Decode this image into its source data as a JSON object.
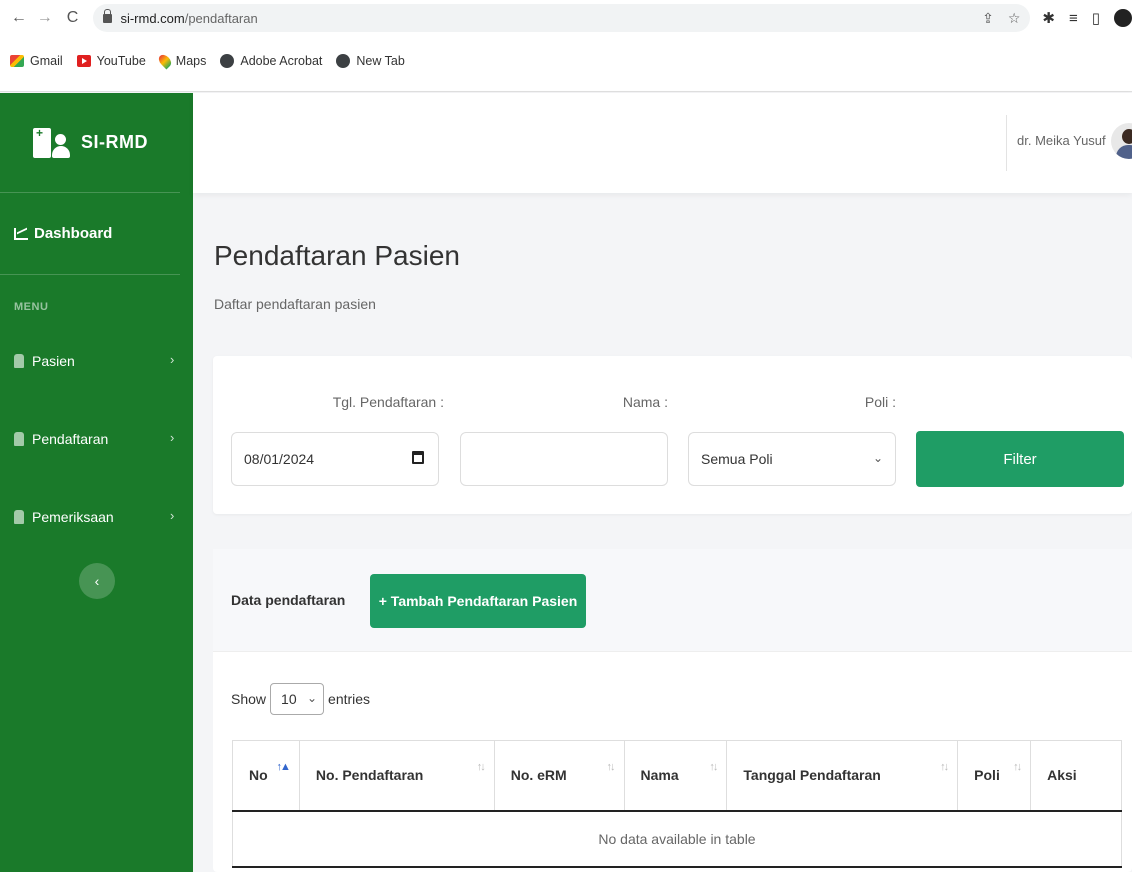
{
  "browser": {
    "url_domain": "si-rmd.com",
    "url_path": "/pendaftaran",
    "bookmarks": [
      "Gmail",
      "YouTube",
      "Maps",
      "Adobe Acrobat",
      "New Tab"
    ]
  },
  "sidebar": {
    "brand": "SI-RMD",
    "dashboard_label": "Dashboard",
    "menu_heading": "MENU",
    "items": [
      {
        "label": "Pasien"
      },
      {
        "label": "Pendaftaran"
      },
      {
        "label": "Pemeriksaan"
      }
    ],
    "collapse_glyph": "‹"
  },
  "topbar": {
    "user_name": "dr. Meika Yusuf"
  },
  "page": {
    "title": "Pendaftaran Pasien",
    "subtitle": "Daftar pendaftaran pasien"
  },
  "filter": {
    "date_label": "Tgl. Pendaftaran :",
    "date_value": "08/01/2024",
    "name_label": "Nama :",
    "name_value": "",
    "poli_label": "Poli :",
    "poli_value": "Semua Poli",
    "button_label": "Filter"
  },
  "data_section": {
    "title": "Data pendaftaran",
    "add_button": "+ Tambah Pendaftaran Pasien",
    "show_label": "Show",
    "show_value": "10",
    "entries_label": "entries",
    "columns": [
      "No",
      "No. Pendaftaran",
      "No. eRM",
      "Nama",
      "Tanggal Pendaftaran",
      "Poli",
      "Aksi"
    ],
    "empty_message": "No data available in table"
  },
  "colors": {
    "sidebar": "#1a7a2a",
    "primary_button": "#1f9d65"
  }
}
